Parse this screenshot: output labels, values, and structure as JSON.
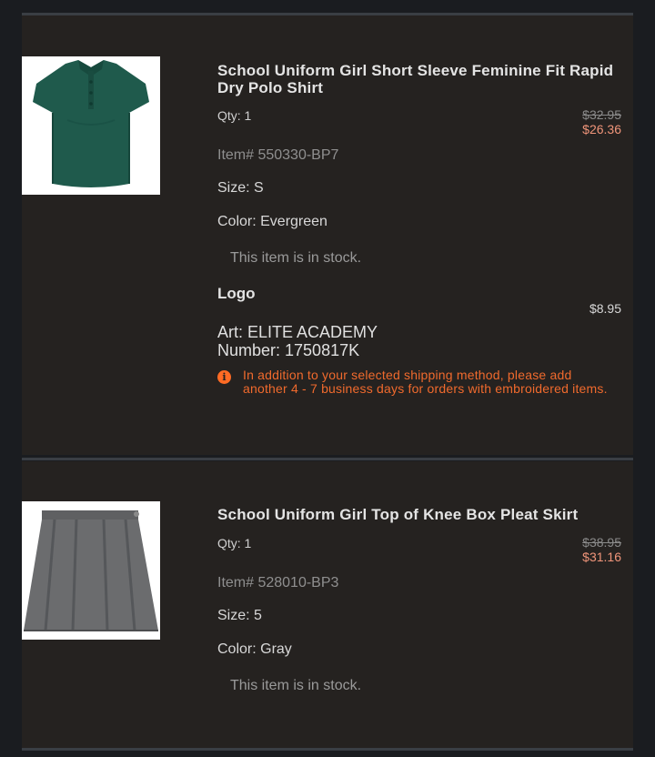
{
  "items": [
    {
      "title": "School Uniform Girl Short Sleeve Feminine Fit Rapid Dry Polo Shirt",
      "qty": "Qty: 1",
      "original_price": "$32.95",
      "sale_price": "$26.36",
      "item_number": "Item# 550330-BP7",
      "size": "Size: S",
      "color": "Color: Evergreen",
      "stock": "This item is in stock.",
      "image": "green-polo-shirt",
      "logo": {
        "label": "Logo",
        "price": "$8.95",
        "art": "Art: ELITE ACADEMY",
        "number": "Number: 1750817K",
        "notice": "In addition to your selected shipping method, please add another 4 - 7 business days for orders with embroidered items."
      }
    },
    {
      "title": "School Uniform Girl Top of Knee Box Pleat Skirt",
      "qty": "Qty: 1",
      "original_price": "$38.95",
      "sale_price": "$31.16",
      "item_number": "Item# 528010-BP3",
      "size": "Size: 5",
      "color": "Color: Gray",
      "stock": "This item is in stock.",
      "image": "gray-pleat-skirt"
    }
  ],
  "colors": {
    "sale_price": "#f0957a",
    "notice": "#f06a2d",
    "panel_bg": "#252220"
  }
}
